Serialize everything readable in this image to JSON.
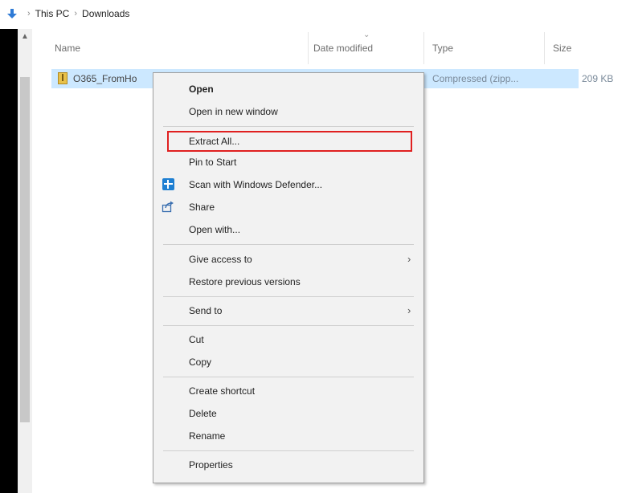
{
  "breadcrumb": {
    "items": [
      "This PC",
      "Downloads"
    ],
    "separator": "›"
  },
  "columns": {
    "name": "Name",
    "date_modified": "Date modified",
    "type": "Type",
    "size": "Size"
  },
  "file": {
    "name": "O365_FromHo",
    "type": "Compressed (zipp...",
    "size": "209 KB"
  },
  "context_menu": {
    "open": "Open",
    "open_new_window": "Open in new window",
    "extract_all": "Extract All...",
    "pin_to_start": "Pin to Start",
    "scan_defender": "Scan with Windows Defender...",
    "share": "Share",
    "open_with": "Open with...",
    "give_access": "Give access to",
    "restore_versions": "Restore previous versions",
    "send_to": "Send to",
    "cut": "Cut",
    "copy": "Copy",
    "create_shortcut": "Create shortcut",
    "delete": "Delete",
    "rename": "Rename",
    "properties": "Properties",
    "submenu_arrow": "›"
  },
  "colors": {
    "selection": "#cce8ff",
    "highlight_box": "#e02020",
    "menu_bg": "#f2f2f2",
    "defender_blue": "#1e7fd2"
  }
}
